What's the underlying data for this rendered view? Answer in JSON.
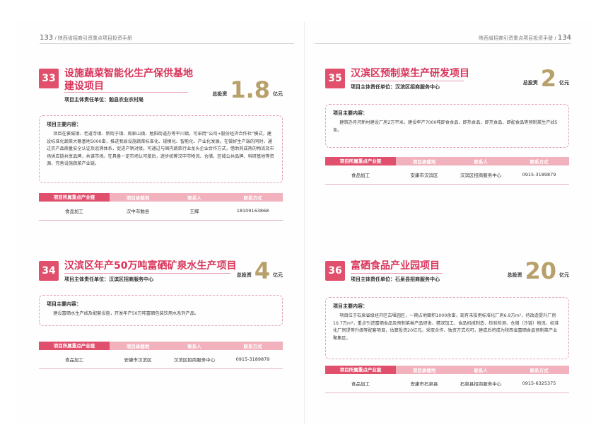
{
  "left_page": {
    "number": "133",
    "title": "陕西省招商引资重点项目投资手册"
  },
  "right_page": {
    "number": "134",
    "title": "陕西省招商引资重点项目投资手册"
  },
  "table_headers": {
    "industry": "项目所属重点产业链",
    "location": "项目承载地",
    "contact": "联系人",
    "phone": "联系方式"
  },
  "desc_heading": "项目主要内容：",
  "invest_label": "总投资",
  "unit": "亿元",
  "projects": [
    {
      "num": "33",
      "title_line1": "设施蔬菜智能化生产保供基地",
      "title_line2": "建设项目",
      "owner": "项目主体责任单位：勉县农业农村局",
      "invest": "1.8",
      "desc": "项目在褒城镇、老道寺镇、新街子镇、周家山镇、勉阳街道办等平川镇，可采用“公司+股份经济合作社”模式，建设标准化蔬菜大棚基地5000亩，推进我县设施蔬菜标准化、规模化、智能化、产业化发展。在做好生产端的同时，通过农产品质量安全认证及追溯体系，促进产销对接。可通过与国内蔬菜行业龙头企业合作方式，借助其成熟的物流及市场供应链共享品牌，共谋市场。在具备一定市场认可度后，逐步统筹汉中市物流、仓储、区域公共品牌、科研基地等资源，完善设施蔬菜产业链。",
      "industry": "食品加工",
      "location": "汉中市勉县",
      "contact": "王辉",
      "phone": "18109163868"
    },
    {
      "num": "35",
      "title_line1": "汉滨区预制菜生产研发项目",
      "owner": "项目主体责任单位：汉滨区招商服务中心",
      "invest": "2",
      "desc": "建筑办月河新村建设厂房2万平米，建设年产7000吨即食食品、即热食品、即烹食品、即配食品等预制菜生产线5条。",
      "industry": "食品加工",
      "location": "安康市汉滨区",
      "contact": "汉滨区招商服务中心",
      "phone": "0915-3189879"
    },
    {
      "num": "34",
      "title_line1": "汉滨区年产50万吨富硒矿泉水生产项目",
      "owner": "项目主体责任单位：汉滨区招商服务中心",
      "invest": "4",
      "desc": "建设富硒水生产线及配套设施，开发年产50万吨富硒包装饮用水系列产品。",
      "industry": "食品加工",
      "location": "安康市汉滨区",
      "contact": "汉滨区招商服务中心",
      "phone": "0915-3189879"
    },
    {
      "num": "36",
      "title_line1": "富硒食品产业园项目",
      "owner": "项目主体责任单位：石泉县招商服务中心",
      "invest": "20",
      "desc": "项目位于石泉省级经开区古堰园区，一期占地面积1000余亩，现有未投用标准化厂房6.9万m²，待改造提升厂房10.7万m²，重点引进富硒食品及预制菜类产品研发、精深加工、食品机械制造、检验检测、仓储（冷链）物流、标准化厂房提等升级等配套项目，估算投资20亿元。采取合作、独资方式均可，建成后将成为陕西省富硒食品预制菜产业聚集区。",
      "industry": "食品加工",
      "location": "安康市石泉县",
      "contact": "石泉县招商服务中心",
      "phone": "0915-6325375"
    }
  ]
}
